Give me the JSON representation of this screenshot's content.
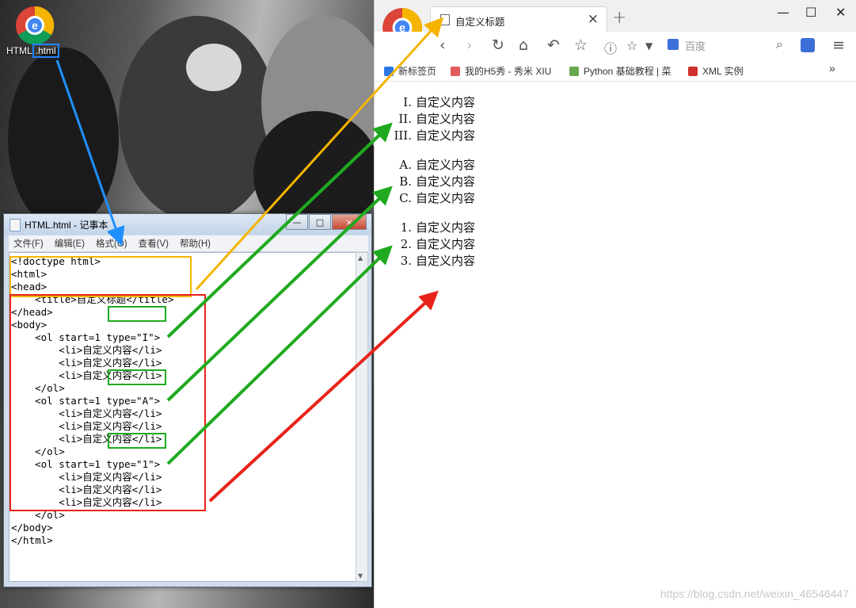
{
  "desktop": {
    "icon_label_prefix": "HTML",
    "icon_label_ext": ".html"
  },
  "notepad": {
    "title": "HTML.html - 记事本",
    "window_buttons": [
      "—",
      "□",
      "×"
    ],
    "menu": [
      "文件(F)",
      "编辑(E)",
      "格式(O)",
      "查看(V)",
      "帮助(H)"
    ],
    "code": "<!doctype html>\n<html>\n<head>\n    <title>自定义标题</title>\n</head>\n<body>\n    <ol start=1 type=\"I\">\n        <li>自定义内容</li>\n        <li>自定义内容</li>\n        <li>自定义内容</li>\n    </ol>\n    <ol start=1 type=\"A\">\n        <li>自定义内容</li>\n        <li>自定义内容</li>\n        <li>自定义内容</li>\n    </ol>\n    <ol start=1 type=\"1\">\n        <li>自定义内容</li>\n        <li>自定义内容</li>\n        <li>自定义内容</li>\n    </ol>\n</body>\n</html>"
  },
  "browser": {
    "tab_title": "自定义标题",
    "tab_close": "×",
    "new_tab": "+",
    "window_buttons": [
      "—",
      "☐",
      "✕"
    ],
    "address_placeholder": "百度",
    "bookmarks": [
      {
        "label": "新标签页",
        "color": "#2b78e4"
      },
      {
        "label": "我的H5秀 - 秀米 XIU",
        "color": "#e25c5c"
      },
      {
        "label": "Python 基础教程 | 菜",
        "color": "#6aa84f"
      },
      {
        "label": "XML 实例",
        "color": "#d0312d"
      }
    ],
    "bookmarks_more": "»",
    "lists": [
      {
        "markers": [
          "I.",
          "II.",
          "III."
        ],
        "items": [
          "自定义内容",
          "自定义内容",
          "自定义内容"
        ]
      },
      {
        "markers": [
          "A.",
          "B.",
          "C."
        ],
        "items": [
          "自定义内容",
          "自定义内容",
          "自定义内容"
        ]
      },
      {
        "markers": [
          "1.",
          "2.",
          "3."
        ],
        "items": [
          "自定义内容",
          "自定义内容",
          "自定义内容"
        ]
      }
    ]
  },
  "watermark": "https://blog.csdn.net/weixin_46546447",
  "annotation_colors": {
    "title_link": "#f5b400",
    "type_link": "#1faa1f",
    "body_link": "#e8231a",
    "file_link": "#1e90ff"
  }
}
